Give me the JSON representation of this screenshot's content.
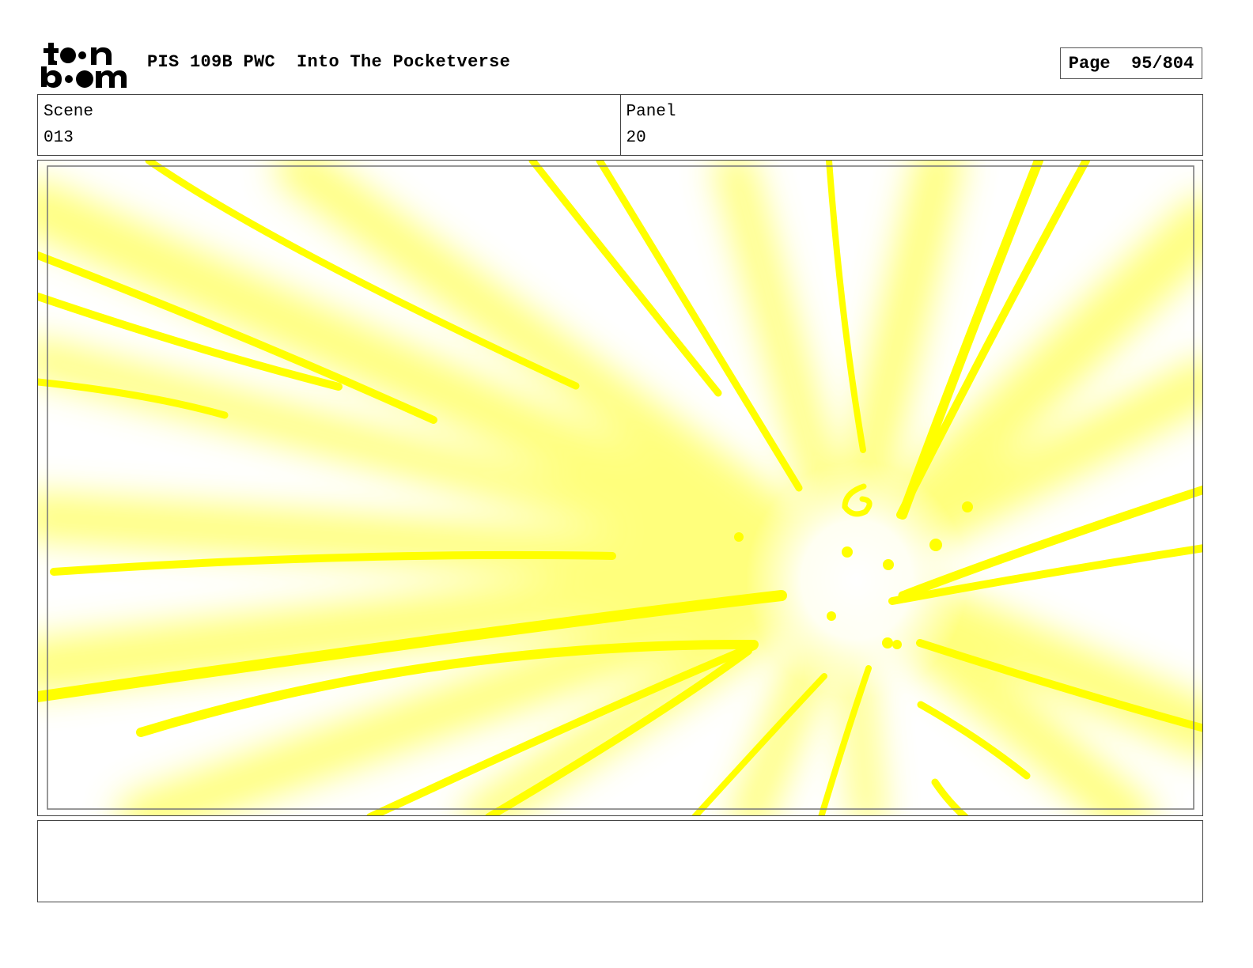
{
  "header": {
    "logo_text": "toon boom",
    "project_title": "PIS 109B PWC  Into The Pocketverse",
    "page_indicator": "Page  95/804"
  },
  "info": {
    "scene_label": "Scene",
    "scene_value": "013",
    "panel_label": "Panel",
    "panel_value": "20"
  },
  "drawing": {
    "description_color": "#ffff00",
    "glow_color": "#ffff66"
  },
  "notes": {
    "text": ""
  }
}
